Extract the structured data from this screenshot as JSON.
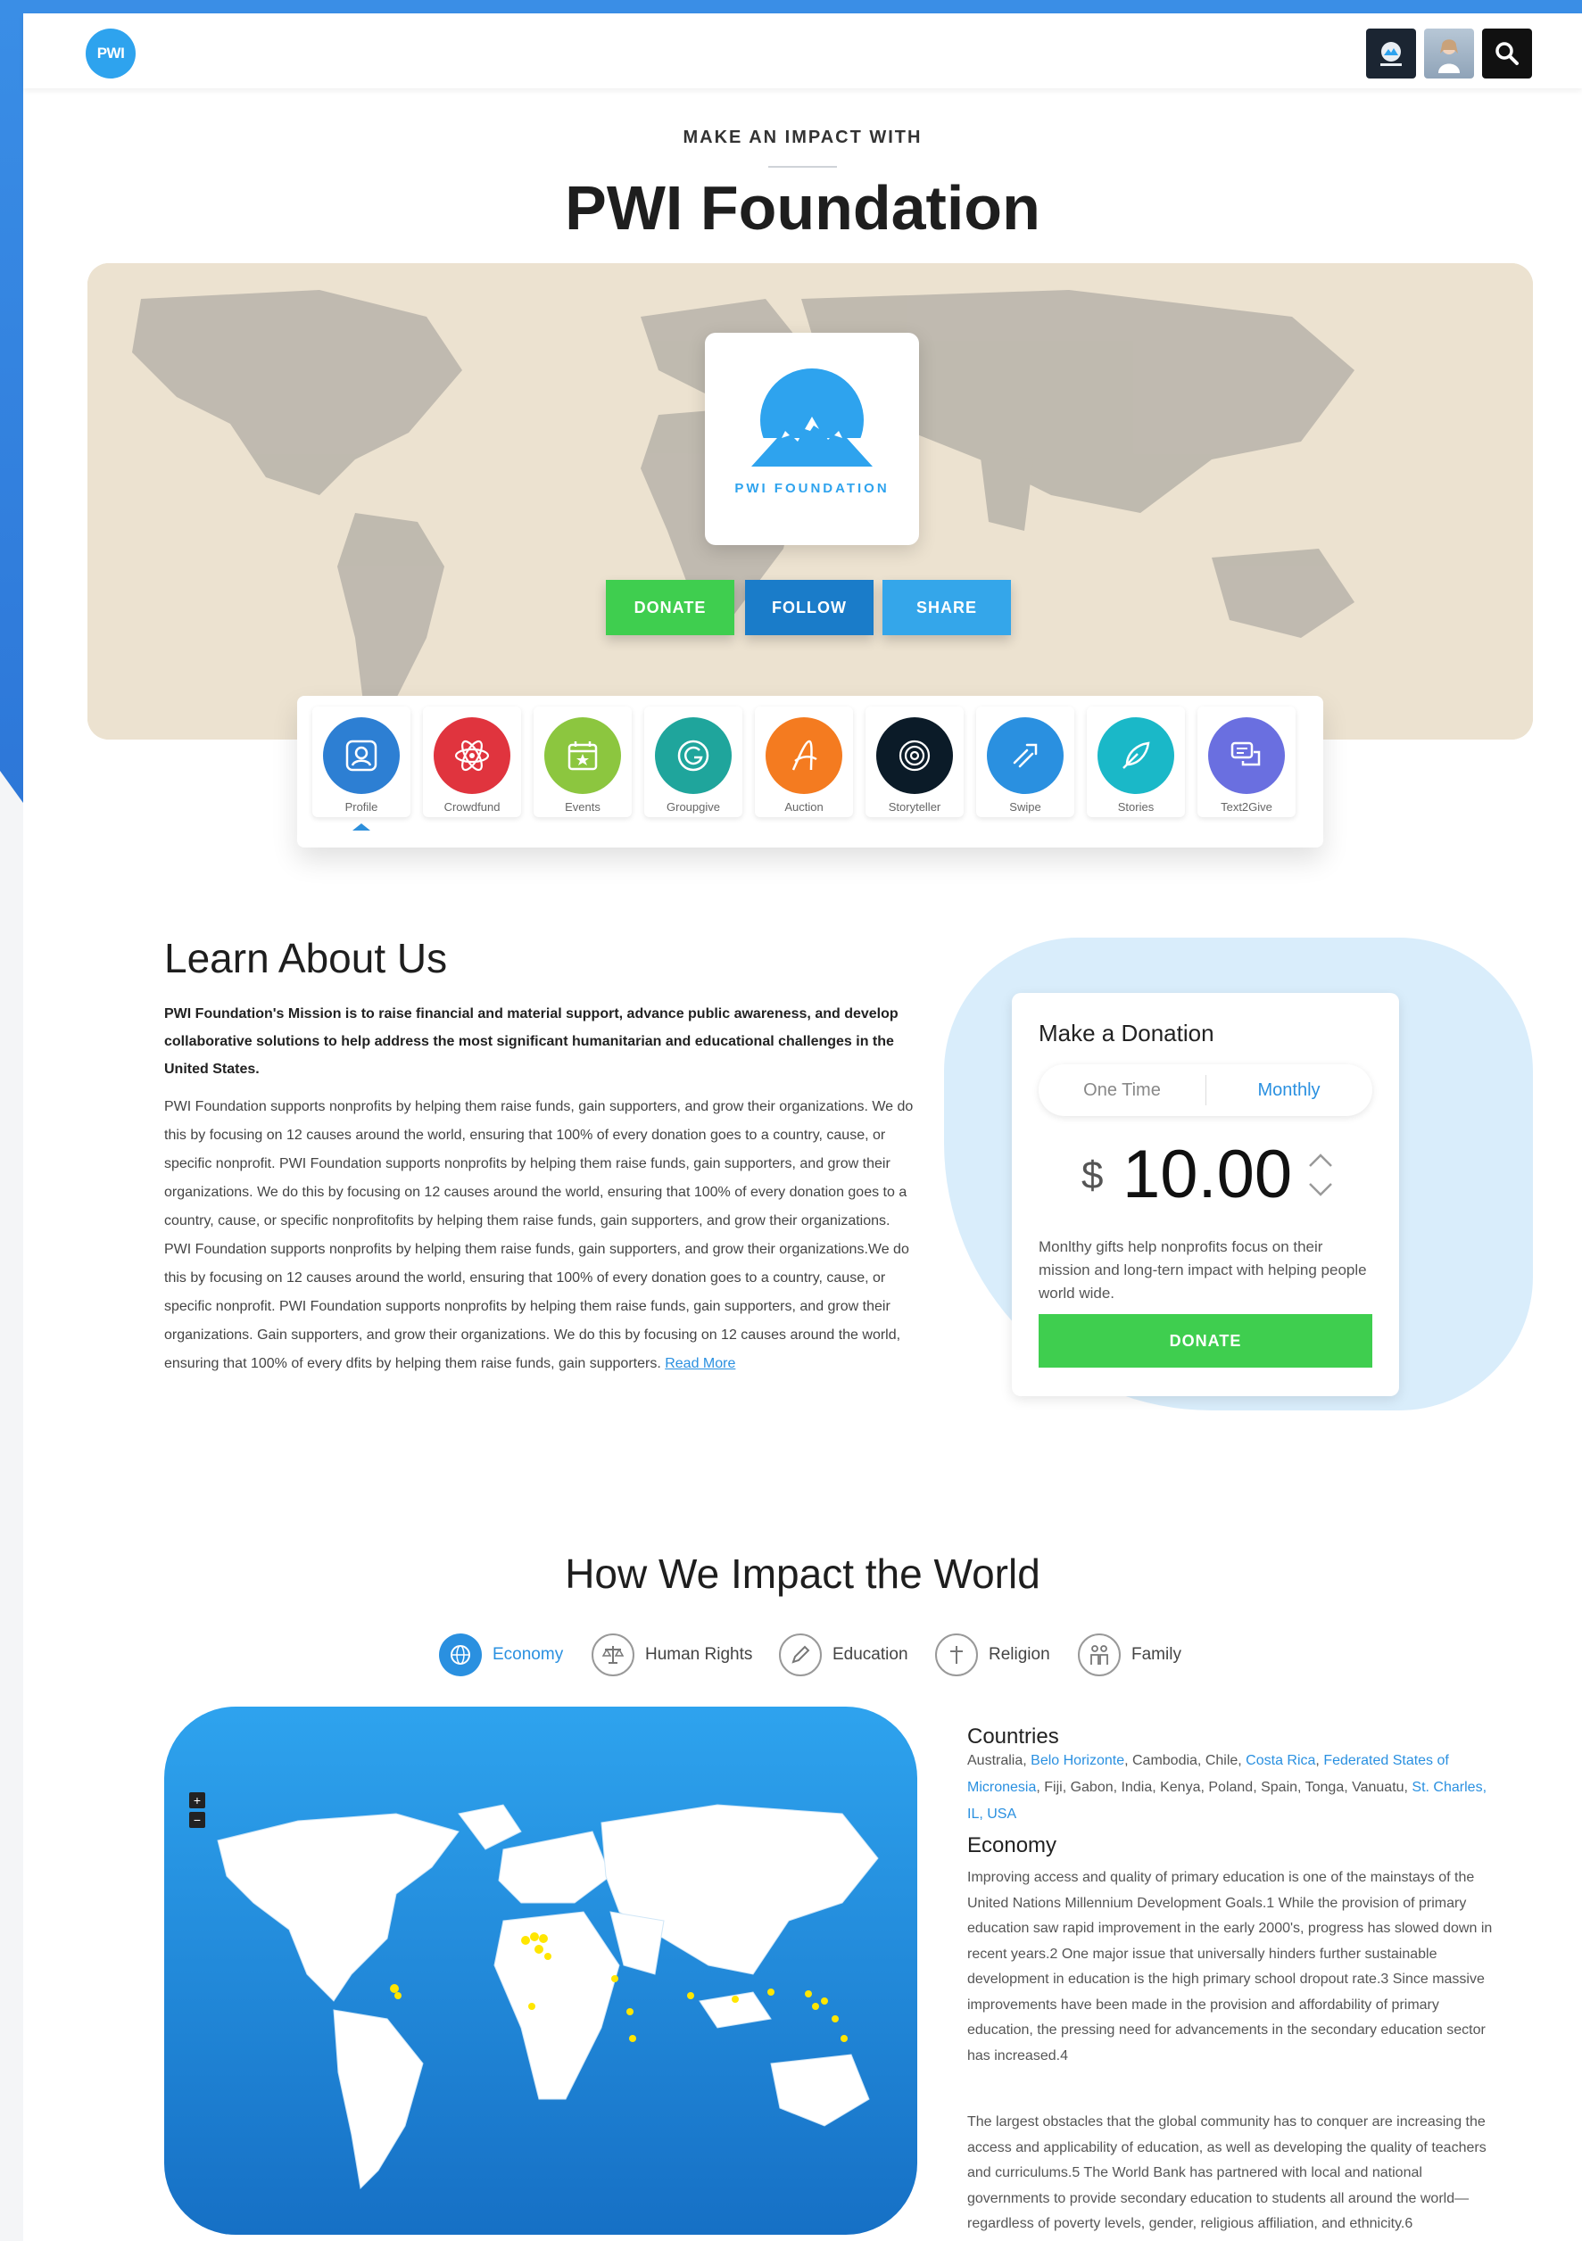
{
  "header": {
    "logo_text": "PWI",
    "search_icon": "search-icon",
    "avatar_icons": [
      "avatar-org",
      "avatar-user"
    ]
  },
  "hero": {
    "eyebrow": "MAKE AN IMPACT WITH",
    "title": "PWI Foundation",
    "card_label": "PWI FOUNDATION",
    "buttons": {
      "donate": "DONATE",
      "follow": "FOLLOW",
      "share": "SHARE"
    },
    "colors": {
      "donate": "#3fce4f",
      "follow": "#1a7cc9",
      "share": "#34a6ea"
    }
  },
  "tools": [
    {
      "label": "Profile",
      "color": "#2d7fd3",
      "icon": "profile-icon"
    },
    {
      "label": "Crowdfund",
      "color": "#e0343e",
      "icon": "atom-icon"
    },
    {
      "label": "Events",
      "color": "#8cc63f",
      "icon": "calendar-star-icon"
    },
    {
      "label": "Groupgive",
      "color": "#1fa59c",
      "icon": "g-letter-icon"
    },
    {
      "label": "Auction",
      "color": "#f47b20",
      "icon": "a-letter-icon"
    },
    {
      "label": "Storyteller",
      "color": "#0b1b28",
      "icon": "target-icon"
    },
    {
      "label": "Swipe",
      "color": "#2a90e0",
      "icon": "swipe-icon"
    },
    {
      "label": "Stories",
      "color": "#1ab8c8",
      "icon": "quill-icon"
    },
    {
      "label": "Text2Give",
      "color": "#6a6fe0",
      "icon": "chat-icon"
    }
  ],
  "learn": {
    "title": "Learn About Us",
    "mission": "PWI Foundation's Mission is to raise financial and material support, advance public awareness, and develop collaborative solutions to help address the most significant humanitarian and educational challenges in the United States.",
    "body": "PWI Foundation supports nonprofits by helping them raise funds, gain supporters, and grow their organizations. We do this by focusing on 12 causes around the world, ensuring that 100% of every donation goes to a country, cause, or specific nonprofit. PWI Foundation supports nonprofits by helping them raise funds, gain supporters, and grow their organizations. We do this by focusing on 12 causes around the world, ensuring that 100% of every donation goes to a country, cause, or specific nonprofitofits by helping them raise funds, gain supporters, and grow their organizations.  PWI Foundation supports nonprofits by helping them raise funds, gain supporters, and grow their organizations.We do this by focusing on 12 causes around the world, ensuring that 100% of every donation goes to a country, cause, or specific nonprofit. PWI Foundation supports nonprofits by helping them raise funds, gain supporters, and grow their organizations. Gain supporters, and grow their organizations. We do this by focusing on 12 causes around the world, ensuring that 100% of every dfits by helping them raise funds, gain supporters.",
    "read_more": "Read More"
  },
  "donation": {
    "title": "Make a Donation",
    "options": [
      "One Time",
      "Monthly"
    ],
    "selected": "Monthly",
    "currency": "$",
    "amount": "10.00",
    "note": "Monlthy gifts help nonprofits focus on their mission and long-tern impact with helping people world wide.",
    "button": "DONATE"
  },
  "impact": {
    "title": "How We Impact the World",
    "categories": [
      {
        "label": "Economy",
        "icon": "globe-icon",
        "active": true
      },
      {
        "label": "Human Rights",
        "icon": "scales-icon",
        "active": false
      },
      {
        "label": "Education",
        "icon": "pencil-icon",
        "active": false
      },
      {
        "label": "Religion",
        "icon": "cross-icon",
        "active": false
      },
      {
        "label": "Family",
        "icon": "family-icon",
        "active": false
      }
    ],
    "map_zoom": {
      "in": "+",
      "out": "−"
    },
    "countries_title": "Countries",
    "countries": [
      {
        "name": "Australia",
        "link": false
      },
      {
        "name": "Belo Horizonte",
        "link": true
      },
      {
        "name": "Cambodia",
        "link": false
      },
      {
        "name": "Chile",
        "link": false
      },
      {
        "name": "Costa Rica",
        "link": true
      },
      {
        "name": "Federated States of Micronesia",
        "link": true
      },
      {
        "name": "Fiji",
        "link": false
      },
      {
        "name": "Gabon",
        "link": false
      },
      {
        "name": "India",
        "link": false
      },
      {
        "name": "Kenya",
        "link": false
      },
      {
        "name": "Poland",
        "link": false
      },
      {
        "name": "Spain",
        "link": false
      },
      {
        "name": "Tonga",
        "link": false
      },
      {
        "name": "Vanuatu",
        "link": false
      },
      {
        "name": "St. Charles, IL, USA",
        "link": true
      }
    ],
    "economy_title": "Economy",
    "economy_p1": "Improving access and quality of primary education is one of the mainstays of the United Nations Millennium Development Goals.1 While the provision of primary education saw rapid improvement in the early 2000's, progress has slowed down in recent years.2 One major issue that universally hinders further sustainable development in education is the high primary school dropout rate.3 Since massive improvements have been made in the provision and affordability of primary education, the pressing need for advancements in the secondary education sector has increased.4",
    "economy_p2": "The largest obstacles that the global community has to conquer are increasing the access and applicability of education, as well as developing the quality of teachers and curriculums.5 The World Bank has partnered with local and national governments to provide secondary education to students all around the world—regardless of poverty levels, gender, religious affiliation, and ethnicity.6"
  }
}
